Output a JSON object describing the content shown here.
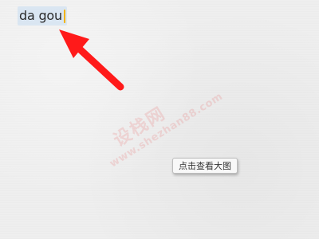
{
  "editor": {
    "typed_text": "da gou",
    "caret_color": "#f2b200",
    "selection_color": "#c6dcf2"
  },
  "annotation": {
    "arrow_color": "#ff1a1a",
    "arrow_icon": "red-arrow-icon"
  },
  "watermark": {
    "cn_text": "设栈网",
    "url_text": "www.shezhan88.com",
    "color": "#eb5a5a"
  },
  "overlay": {
    "view_large_label": "点击查看大图"
  }
}
